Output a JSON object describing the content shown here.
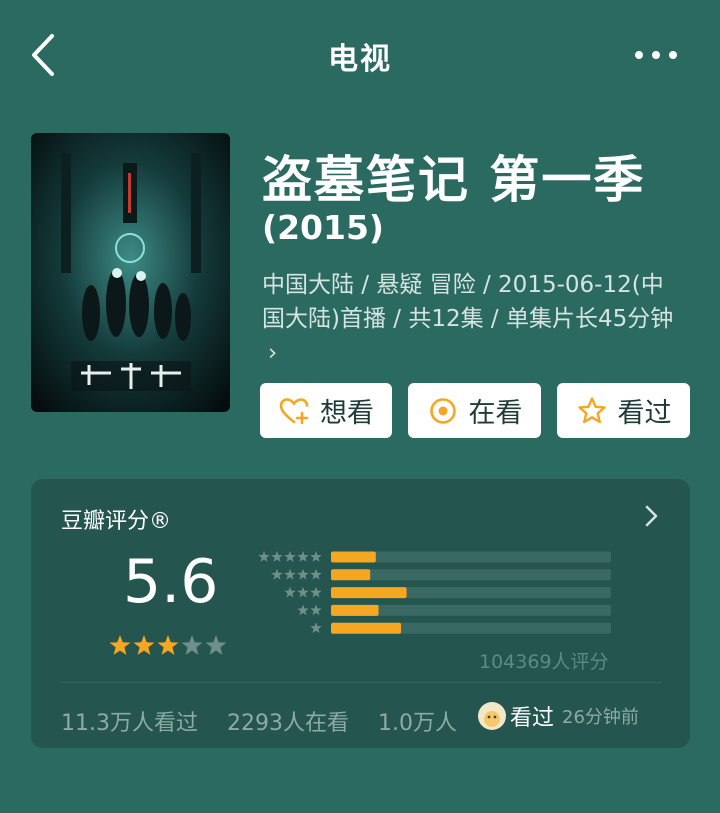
{
  "nav": {
    "title": "电视",
    "back_icon": "chevron-left-icon",
    "more_icon": "more-dots-icon"
  },
  "movie": {
    "title": "盗墓笔记 第一季",
    "year": "(2015)",
    "meta": "中国大陆 / 悬疑 冒险 / 2015-06-12(中国大陆)首播 / 共12集 / 单集片长45分钟",
    "meta_more": "›",
    "poster_icon": "poster-image"
  },
  "actions": [
    {
      "label": "想看",
      "icon": "heart-plus-icon"
    },
    {
      "label": "在看",
      "icon": "circle-dot-icon"
    },
    {
      "label": "看过",
      "icon": "star-outline-icon"
    }
  ],
  "rating": {
    "title": "豆瓣评分®",
    "score": "5.6",
    "stars_filled": 3,
    "stars_total": 5,
    "distribution": [
      {
        "stars": 5,
        "fraction": 0.16
      },
      {
        "stars": 4,
        "fraction": 0.14
      },
      {
        "stars": 3,
        "fraction": 0.27
      },
      {
        "stars": 2,
        "fraction": 0.17
      },
      {
        "stars": 1,
        "fraction": 0.25
      }
    ],
    "count": "104369人评分"
  },
  "stats": {
    "watched": "11.3万人看过",
    "watching": "2293人在看",
    "want": "1.0万人",
    "friend_status": "看过",
    "friend_time": "26分钟前"
  },
  "colors": {
    "background": "#2a6a61",
    "card": "#24554f",
    "accent": "#f5a623",
    "bar_track": "#3a6863"
  }
}
